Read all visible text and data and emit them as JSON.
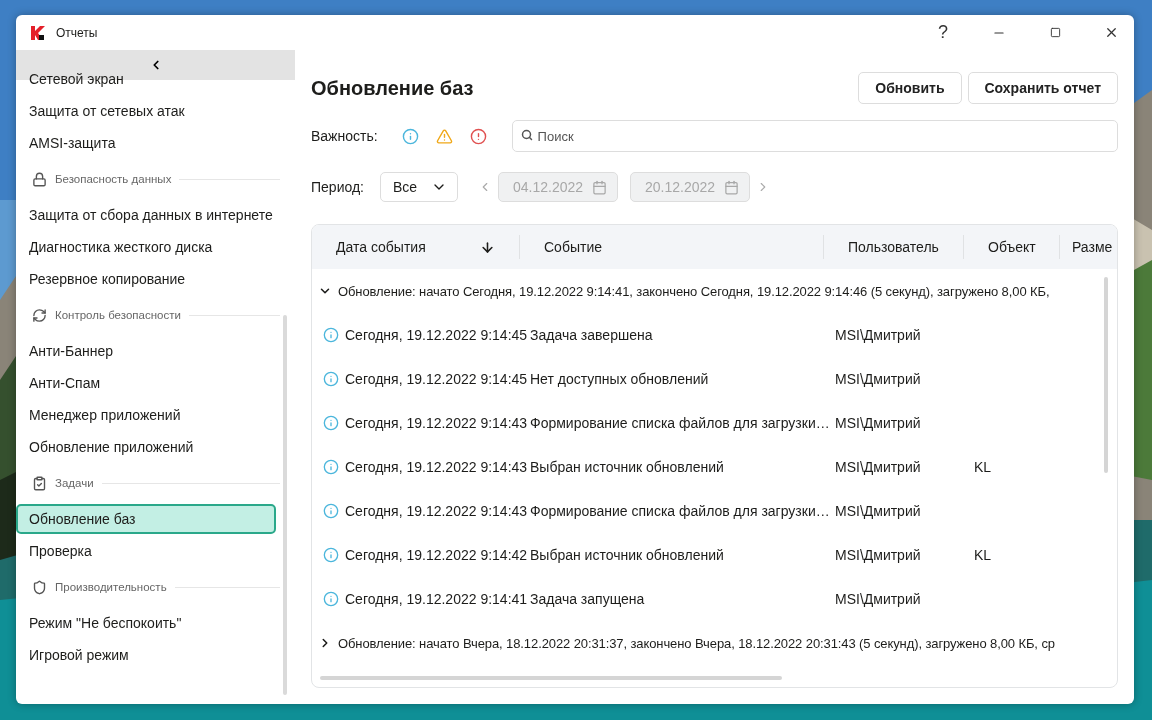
{
  "window": {
    "title": "Отчеты",
    "help": "?"
  },
  "sidebar": {
    "items": [
      {
        "kind": "item",
        "label": "Сетевой экран",
        "selected": false
      },
      {
        "kind": "item",
        "label": "Защита от сетевых атак",
        "selected": false
      },
      {
        "kind": "item",
        "label": "AMSI-защита",
        "selected": false
      },
      {
        "kind": "section",
        "label": "Безопасность данных"
      },
      {
        "kind": "item",
        "label": "Защита от сбора данных в интернете",
        "selected": false
      },
      {
        "kind": "item",
        "label": "Диагностика жесткого диска",
        "selected": false
      },
      {
        "kind": "item",
        "label": "Резервное копирование",
        "selected": false
      },
      {
        "kind": "section",
        "label": "Контроль безопасности"
      },
      {
        "kind": "item",
        "label": "Анти-Баннер",
        "selected": false
      },
      {
        "kind": "item",
        "label": "Анти-Спам",
        "selected": false
      },
      {
        "kind": "item",
        "label": "Менеджер приложений",
        "selected": false
      },
      {
        "kind": "item",
        "label": "Обновление приложений",
        "selected": false
      },
      {
        "kind": "section",
        "label": "Задачи"
      },
      {
        "kind": "item",
        "label": "Обновление баз",
        "selected": true
      },
      {
        "kind": "item",
        "label": "Проверка",
        "selected": false
      },
      {
        "kind": "section",
        "label": "Производительность"
      },
      {
        "kind": "item",
        "label": "Режим \"Не беспокоить\"",
        "selected": false
      },
      {
        "kind": "item",
        "label": "Игровой режим",
        "selected": false
      }
    ]
  },
  "page": {
    "title": "Обновление баз",
    "buttons": [
      "Обновить",
      "Сохранить отчет"
    ]
  },
  "filters": {
    "importance_label": "Важность:",
    "search": {
      "placeholder": "Поиск"
    },
    "period_label": "Период:",
    "period": {
      "value": "Все"
    },
    "from": {
      "value": "04.12.2022",
      "disabled": true
    },
    "to": {
      "value": "20.12.2022",
      "disabled": true
    }
  },
  "table": {
    "columns": [
      {
        "label": "Дата события",
        "sorted": true
      },
      {
        "label": "Событие"
      },
      {
        "label": "Пользователь"
      },
      {
        "label": "Объект"
      },
      {
        "label": "Разме"
      }
    ],
    "rows": [
      {
        "kind": "group",
        "expanded": true,
        "text": "Обновление: начато Сегодня, 19.12.2022 9:14:41, закончено Сегодня, 19.12.2022 9:14:46 (5 секунд), загружено 8,00 КБ,"
      },
      {
        "kind": "event",
        "date": "Сегодня, 19.12.2022 9:14:45",
        "event": "Задача завершена",
        "user": "MSI\\Дмитрий"
      },
      {
        "kind": "event",
        "date": "Сегодня, 19.12.2022 9:14:45",
        "event": "Нет доступных обновлений",
        "user": "MSI\\Дмитрий"
      },
      {
        "kind": "event",
        "date": "Сегодня, 19.12.2022 9:14:43",
        "event": "Формирование списка файлов для загрузки…",
        "user": "MSI\\Дмитрий"
      },
      {
        "kind": "event",
        "date": "Сегодня, 19.12.2022 9:14:43",
        "event": "Выбран источник обновлений",
        "user": "MSI\\Дмитрий",
        "object": "KL"
      },
      {
        "kind": "event",
        "date": "Сегодня, 19.12.2022 9:14:43",
        "event": "Формирование списка файлов для загрузки…",
        "user": "MSI\\Дмитрий"
      },
      {
        "kind": "event",
        "date": "Сегодня, 19.12.2022 9:14:42",
        "event": "Выбран источник обновлений",
        "user": "MSI\\Дмитрий",
        "object": "KL"
      },
      {
        "kind": "event",
        "date": "Сегодня, 19.12.2022 9:14:41",
        "event": "Задача запущена",
        "user": "MSI\\Дмитрий"
      },
      {
        "kind": "group",
        "expanded": false,
        "text": "Обновление: начато Вчера, 18.12.2022 20:31:37, закончено Вчера, 18.12.2022 20:31:43 (5 секунд), загружено 8,00 КБ, ср"
      }
    ]
  }
}
